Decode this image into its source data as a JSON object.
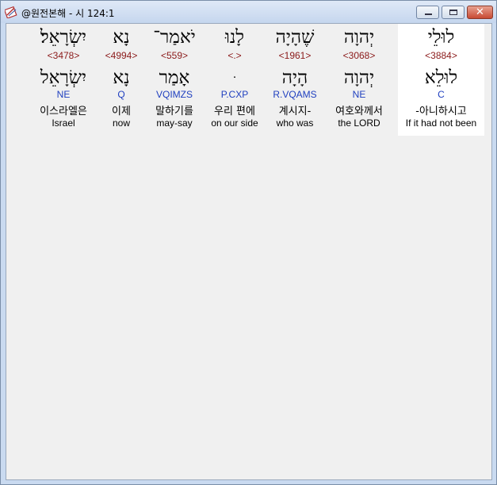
{
  "window": {
    "title": "@원전본해 - 시 124:1",
    "icon": "bible-app-icon",
    "close_glyph": "✕"
  },
  "words": [
    {
      "hebrew": "לוּלֵי",
      "strong": "<3884>",
      "lemma": "לוּלֵא",
      "morph": "C",
      "korean": "-아니하시고",
      "english": "If it had not been",
      "selected": true
    },
    {
      "hebrew": "יְהוָה",
      "strong": "<3068>",
      "lemma": "יְהוָה",
      "morph": "NE",
      "korean": "여호와께서",
      "english": "the LORD",
      "selected": false
    },
    {
      "hebrew": "שֶׁהָיָה",
      "strong": "<1961>",
      "lemma": "הָיָה",
      "morph": "R.VQAMS",
      "korean": "계시지-",
      "english": "who was",
      "selected": false
    },
    {
      "hebrew": "לָנוּ",
      "strong": "<.>",
      "lemma": "ּ",
      "morph": "P.CXP",
      "korean": "우리 편에",
      "english": "on our side",
      "selected": false
    },
    {
      "hebrew": "יֹאמַר־",
      "strong": "<559>",
      "lemma": "אָמַר",
      "morph": "VQIMZS",
      "korean": "말하기를",
      "english": "may-say",
      "selected": false
    },
    {
      "hebrew": "נָא",
      "strong": "<4994>",
      "lemma": "נָא",
      "morph": "Q",
      "korean": "이제",
      "english": "now",
      "selected": false
    },
    {
      "hebrew": "יִשְׂרָאֵל׃",
      "strong": "<3478>",
      "lemma": "יִשְׂרָאֵל",
      "morph": "NE",
      "korean": "이스라엘은",
      "english": "Israel",
      "selected": false
    }
  ],
  "colors": {
    "strong_number": "#8b1a1a",
    "morphology": "#1f3fbf",
    "selected_background": "#ffffff"
  }
}
